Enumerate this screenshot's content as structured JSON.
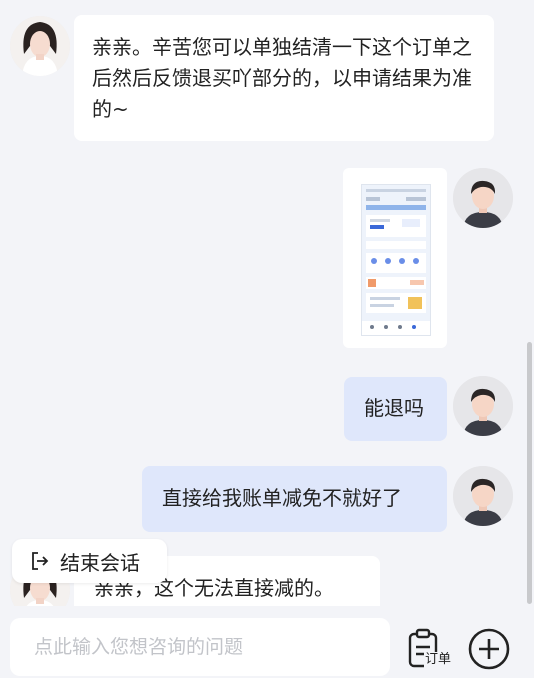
{
  "messages": [
    {
      "role": "agent",
      "text": "亲亲。辛苦您可以单独结清一下这个订单之后然后反馈退买吖部分的，以申请结果为准的~"
    },
    {
      "role": "user",
      "type": "image"
    },
    {
      "role": "user",
      "text": "能退吗"
    },
    {
      "role": "user",
      "text": "直接给我账单减免不就好了"
    },
    {
      "role": "agent",
      "text": "亲亲，这个无法直接减的。"
    }
  ],
  "end_session_label": "结束会话",
  "input": {
    "placeholder": "点此输入您想咨询的问题",
    "value": ""
  },
  "order_label": "订单",
  "colors": {
    "background": "#f3f4f8",
    "agent_bubble": "#ffffff",
    "user_bubble": "#dfe7fb",
    "placeholder": "#c2c4c9"
  },
  "icons": [
    "agent-avatar",
    "user-avatar",
    "logout-icon",
    "clipboard-icon",
    "plus-circle-icon"
  ]
}
